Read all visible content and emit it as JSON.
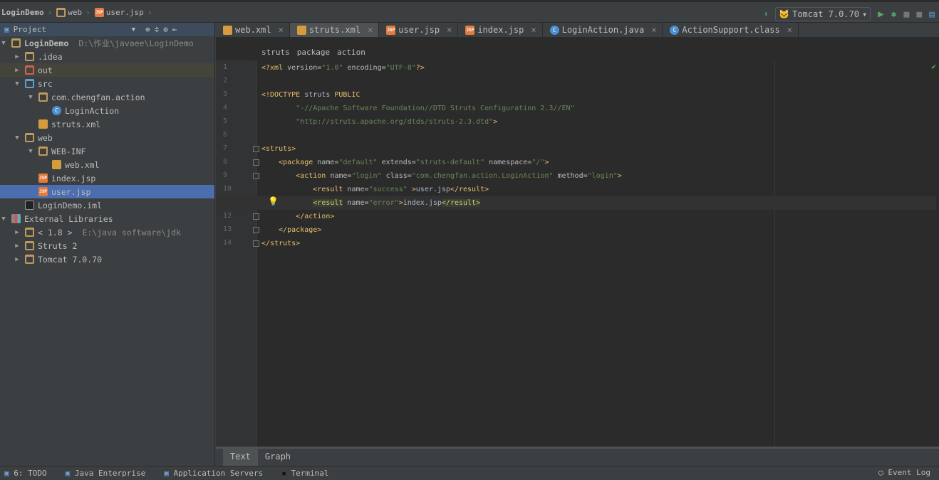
{
  "breadcrumb": [
    "LoginDemo",
    "web",
    "user.jsp"
  ],
  "run": {
    "config": "Tomcat 7.0.70"
  },
  "project": {
    "title": "Project",
    "tree": [
      {
        "label": "LoginDemo",
        "extra": "D:\\作业\\javaee\\LoginDemo",
        "level": 0,
        "arrow": "open",
        "icon": "module",
        "bold": true
      },
      {
        "label": ".idea",
        "level": 1,
        "arrow": "closed",
        "icon": "folder"
      },
      {
        "label": "out",
        "level": 1,
        "arrow": "closed",
        "icon": "folder-excluded",
        "excl": true
      },
      {
        "label": "src",
        "level": 1,
        "arrow": "open",
        "icon": "folder-source"
      },
      {
        "label": "com.chengfan.action",
        "level": 2,
        "arrow": "open",
        "icon": "package"
      },
      {
        "label": "LoginAction",
        "level": 3,
        "arrow": "none",
        "icon": "class"
      },
      {
        "label": "struts.xml",
        "level": 2,
        "arrow": "none",
        "icon": "xml"
      },
      {
        "label": "web",
        "level": 1,
        "arrow": "open",
        "icon": "folder-web"
      },
      {
        "label": "WEB-INF",
        "level": 2,
        "arrow": "open",
        "icon": "folder"
      },
      {
        "label": "web.xml",
        "level": 3,
        "arrow": "none",
        "icon": "xml"
      },
      {
        "label": "index.jsp",
        "level": 2,
        "arrow": "none",
        "icon": "jsp"
      },
      {
        "label": "user.jsp",
        "level": 2,
        "arrow": "none",
        "icon": "jsp",
        "selected": true
      },
      {
        "label": "LoginDemo.iml",
        "level": 1,
        "arrow": "none",
        "icon": "iml"
      },
      {
        "label": "External Libraries",
        "level": 0,
        "arrow": "open",
        "icon": "libraries"
      },
      {
        "label": "< 1.8 >",
        "extra": "E:\\java software\\jdk",
        "level": 1,
        "arrow": "closed",
        "icon": "jdk"
      },
      {
        "label": "Struts 2",
        "level": 1,
        "arrow": "closed",
        "icon": "library"
      },
      {
        "label": "Tomcat 7.0.70",
        "level": 1,
        "arrow": "closed",
        "icon": "library"
      }
    ]
  },
  "tabs": [
    {
      "label": "web.xml",
      "icon": "xml"
    },
    {
      "label": "struts.xml",
      "icon": "xml",
      "active": true
    },
    {
      "label": "user.jsp",
      "icon": "jsp"
    },
    {
      "label": "index.jsp",
      "icon": "jsp"
    },
    {
      "label": "LoginAction.java",
      "icon": "class"
    },
    {
      "label": "ActionSupport.class",
      "icon": "class"
    }
  ],
  "editor_breadcrumb": [
    "struts",
    "package",
    "action"
  ],
  "code": [
    [
      [
        "tag",
        "<?xml "
      ],
      [
        "attr",
        "version="
      ],
      [
        "val",
        "\"1.0\""
      ],
      [
        "attr",
        " encoding="
      ],
      [
        "val",
        "\"UTF-8\""
      ],
      [
        "tag",
        "?>"
      ]
    ],
    [],
    [
      [
        "tag",
        "<!DOCTYPE "
      ],
      [
        "txt",
        "struts "
      ],
      [
        "tag",
        "PUBLIC"
      ]
    ],
    [
      [
        "txt",
        "        "
      ],
      [
        "val",
        "\"-//Apache Software Foundation//DTD Struts Configuration 2.3//EN\""
      ]
    ],
    [
      [
        "txt",
        "        "
      ],
      [
        "val",
        "\"http://struts.apache.org/dtds/struts-2.3.dtd\""
      ],
      [
        "tag",
        ">"
      ]
    ],
    [],
    [
      [
        "tag",
        "<struts>"
      ]
    ],
    [
      [
        "txt",
        "    "
      ],
      [
        "tag",
        "<package "
      ],
      [
        "attr",
        "name="
      ],
      [
        "val",
        "\"default\""
      ],
      [
        "attr",
        " extends="
      ],
      [
        "val",
        "\"struts-default\""
      ],
      [
        "attr",
        " namespace="
      ],
      [
        "val",
        "\"/\""
      ],
      [
        "tag",
        ">"
      ]
    ],
    [
      [
        "txt",
        "        "
      ],
      [
        "tag",
        "<action "
      ],
      [
        "attr",
        "name="
      ],
      [
        "val",
        "\"login\""
      ],
      [
        "attr",
        " class="
      ],
      [
        "val",
        "\"com.chengfan.action.LoginAction\""
      ],
      [
        "attr",
        " method="
      ],
      [
        "val",
        "\"login\""
      ],
      [
        "tag",
        ">"
      ]
    ],
    [
      [
        "txt",
        "            "
      ],
      [
        "tag",
        "<result "
      ],
      [
        "attr",
        "name="
      ],
      [
        "val",
        "\"success\" "
      ],
      [
        "tag",
        ">"
      ],
      [
        "txt",
        "user.jsp"
      ],
      [
        "tag",
        "</result>"
      ]
    ],
    [
      [
        "txt",
        "            "
      ],
      [
        "hltag",
        "<result"
      ],
      [
        "attr",
        " name="
      ],
      [
        "val",
        "\"error\""
      ],
      [
        "tag",
        ">"
      ],
      [
        "txt",
        "index.jsp"
      ],
      [
        "hltag",
        "</result>"
      ]
    ],
    [
      [
        "txt",
        "        "
      ],
      [
        "tag",
        "</action>"
      ]
    ],
    [
      [
        "txt",
        "    "
      ],
      [
        "tag",
        "</package>"
      ]
    ],
    [
      [
        "tag",
        "</struts>"
      ]
    ]
  ],
  "bottom_tabs": [
    {
      "label": "Text",
      "active": true
    },
    {
      "label": "Graph"
    }
  ],
  "status": [
    {
      "label": "6: TODO",
      "icon": "todo"
    },
    {
      "label": "Java Enterprise",
      "icon": "java-enterprise"
    },
    {
      "label": "Application Servers",
      "icon": "app-servers"
    },
    {
      "label": "Terminal",
      "icon": "terminal"
    }
  ],
  "event_log": "Event Log",
  "colors": {
    "selection": "#4b6eaf",
    "editor_bg": "#2b2b2b",
    "tag": "#e8bf6a",
    "value": "#6a8759"
  }
}
